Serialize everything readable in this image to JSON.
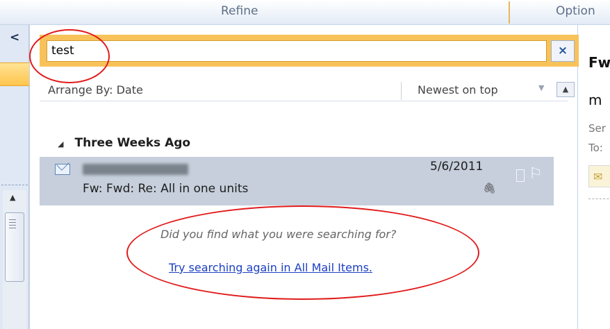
{
  "ribbon": {
    "refine_label": "Refine",
    "options_label": "Option"
  },
  "leftnav": {
    "collapse_glyph": "<"
  },
  "search": {
    "query": "test",
    "clear_glyph": "×"
  },
  "arrange": {
    "label": "Arrange By: Date",
    "order": "Newest on top"
  },
  "group": {
    "label": "Three Weeks Ago"
  },
  "mail_item": {
    "date": "5/6/2011",
    "subject": "Fw: Fwd: Re: All in one units"
  },
  "prompt": {
    "question": "Did you find what you were searching for?",
    "link": "Try searching again in All Mail Items."
  },
  "reading_pane": {
    "title_fragment": "Fw",
    "subtitle_fragment": "m",
    "sent_fragment": "Ser",
    "to_fragment": "To:"
  },
  "icons": {
    "envelope": "envelope-icon",
    "attachment": "paperclip-icon",
    "flag": "flag-icon"
  },
  "colors": {
    "search_accent": "#f8c25a",
    "selected_row": "#c6cfdb",
    "link": "#1b3fc2",
    "annotation": "#e11b1b"
  }
}
